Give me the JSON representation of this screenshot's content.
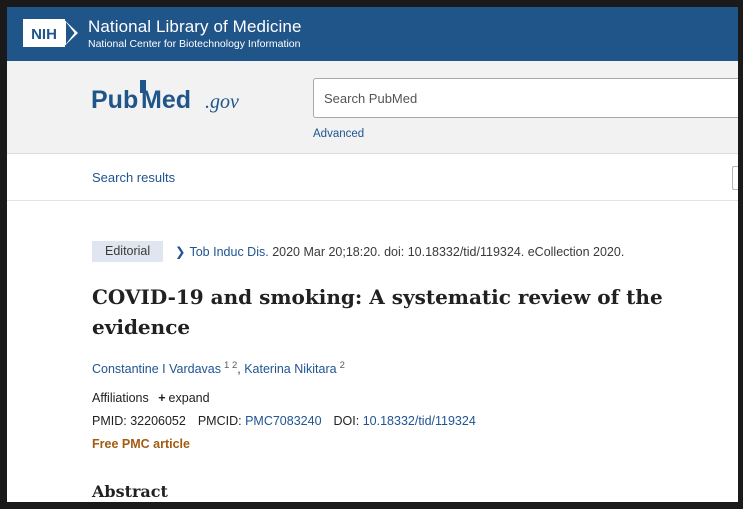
{
  "header": {
    "nih_badge": "NIH",
    "title": "National Library of Medicine",
    "subtitle": "National Center for Biotechnology Information"
  },
  "search": {
    "logo_pub": "Pub",
    "logo_med": "Med",
    "logo_gov": ".gov",
    "placeholder": "Search PubMed",
    "advanced_label": "Advanced"
  },
  "nav": {
    "search_results_label": "Search results"
  },
  "article": {
    "type_badge": "Editorial",
    "journal": "Tob Induc Dis.",
    "citation_rest": "2020 Mar 20;18:20. doi: 10.18332/tid/119324. eCollection 2020.",
    "title": "COVID-19 and smoking: A systematic review of the evidence",
    "authors": [
      {
        "name": "Constantine I Vardavas",
        "affils": "1 2",
        "sep": ", "
      },
      {
        "name": "Katerina Nikitara",
        "affils": "2",
        "sep": ""
      }
    ],
    "affiliations_label": "Affiliations",
    "expand_label": "expand",
    "pmid_label": "PMID:",
    "pmid": "32206052",
    "pmcid_label": "PMCID:",
    "pmcid": "PMC7083240",
    "doi_label": "DOI:",
    "doi": "10.18332/tid/119324",
    "free_pmc_label": "Free PMC article",
    "abstract_heading": "Abstract"
  },
  "colors": {
    "nih_banner": "#20558a",
    "link": "#205493",
    "free_pmc": "#a35b12",
    "badge_bg": "#dfe6ef"
  }
}
